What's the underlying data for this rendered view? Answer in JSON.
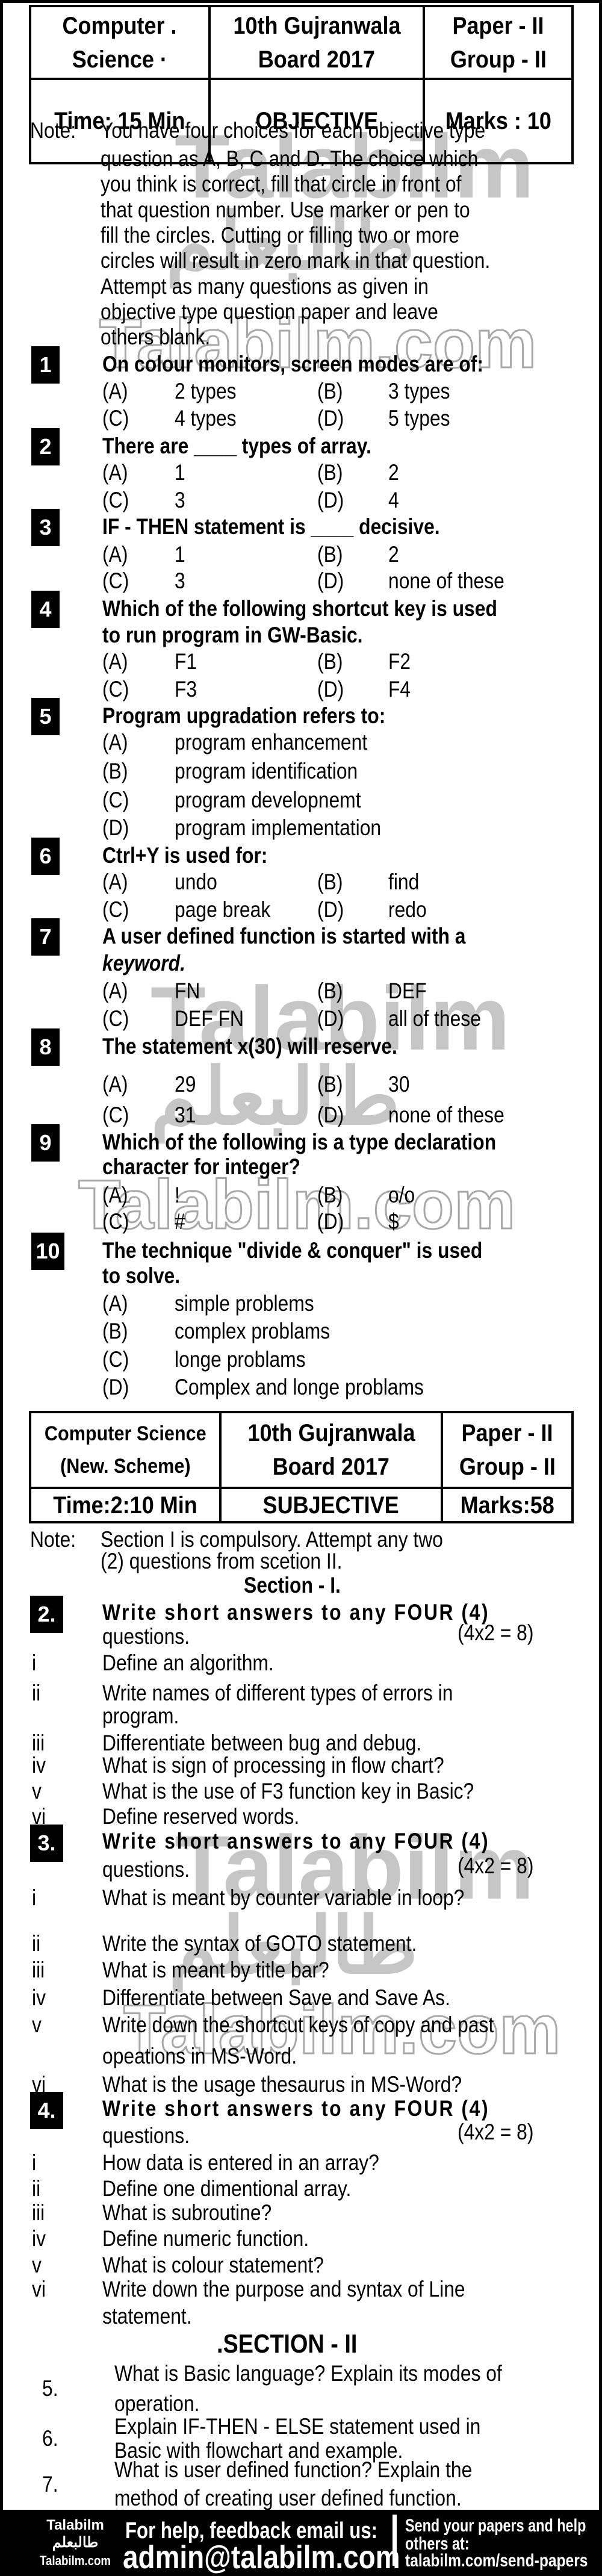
{
  "objective": {
    "header": {
      "subject": [
        "Computer .",
        "Science ·"
      ],
      "board": [
        "10th Gujranwala",
        "Board 2017"
      ],
      "paper": [
        "Paper - II",
        "Group - II"
      ],
      "time": "Time: 15 Min",
      "type": "OBJECTIVE",
      "marks": "Marks : 10"
    },
    "note_label": "Note:",
    "note_lines": [
      "You have four choices for each objective type",
      "question as A, B, C and D. The choice which",
      "you think is correct, fill that circle in front of",
      "that question number. Use marker or pen to",
      "fill the circles. Cutting or filling two or more",
      "circles will result in zero mark in that question.",
      "Attempt as many questions as given in",
      "objective type question paper and leave",
      "others blank."
    ],
    "questions": [
      {
        "num": "1",
        "lines": [
          "On colour monitors, screen modes are of:"
        ],
        "options": [
          [
            "(A)",
            "2 types"
          ],
          [
            "(B)",
            "3 types"
          ],
          [
            "(C)",
            "4 types"
          ],
          [
            "(D)",
            "5 types"
          ]
        ]
      },
      {
        "num": "2",
        "lines": [
          "There are ____ types of array."
        ],
        "options": [
          [
            "(A)",
            "1"
          ],
          [
            "(B)",
            "2"
          ],
          [
            "(C)",
            "3"
          ],
          [
            "(D)",
            "4"
          ]
        ]
      },
      {
        "num": "3",
        "lines": [
          "IF - THEN statement is ____ decisive."
        ],
        "options": [
          [
            "(A)",
            "1"
          ],
          [
            "(B)",
            "2"
          ],
          [
            "(C)",
            "3"
          ],
          [
            "(D)",
            "none of these"
          ]
        ]
      },
      {
        "num": "4",
        "lines": [
          "Which of the following shortcut key is used",
          "to run program in GW-Basic."
        ],
        "options": [
          [
            "(A)",
            "F1"
          ],
          [
            "(B)",
            "F2"
          ],
          [
            "(C)",
            "F3"
          ],
          [
            "(D)",
            "F4"
          ]
        ]
      },
      {
        "num": "5",
        "lines": [
          "Program upgradation refers to:"
        ],
        "options": [
          [
            "(A)",
            "program enhancement"
          ],
          [
            "(B)",
            "program identification"
          ],
          [
            "(C)",
            "program developnemt"
          ],
          [
            "(D)",
            "program implementation"
          ]
        ]
      },
      {
        "num": "6",
        "lines": [
          "Ctrl+Y is used for:"
        ],
        "options": [
          [
            "(A)",
            "undo"
          ],
          [
            "(B)",
            "find"
          ],
          [
            "(C)",
            "page break"
          ],
          [
            "(D)",
            "redo"
          ]
        ]
      },
      {
        "num": "7",
        "lines": [
          "A user defined function is started with a",
          "keyword."
        ],
        "options": [
          [
            "(A)",
            "FN"
          ],
          [
            "(B)",
            "DEF"
          ],
          [
            "(C)",
            "DEF FN"
          ],
          [
            "(D)",
            "all of these"
          ]
        ]
      },
      {
        "num": "8",
        "lines": [
          "The statement x(30) will reserve."
        ],
        "options": [
          [
            "(A)",
            "29"
          ],
          [
            "(B)",
            "30"
          ],
          [
            "(C)",
            "31"
          ],
          [
            "(D)",
            "none of these"
          ]
        ]
      },
      {
        "num": "9",
        "lines": [
          "Which of the following is a type declaration",
          "character for integer?"
        ],
        "options": [
          [
            "(A)",
            "!"
          ],
          [
            "(B)",
            "o/o"
          ],
          [
            "(C)",
            "#"
          ],
          [
            "(D)",
            "$"
          ]
        ]
      },
      {
        "num": "10",
        "lines": [
          "The technique \"divide & conquer\" is used",
          "to solve."
        ],
        "options": [
          [
            "(A)",
            "simple problems"
          ],
          [
            "(B)",
            "complex problams"
          ],
          [
            "(C)",
            "longe problams"
          ],
          [
            "(D)",
            "Complex and longe problams"
          ]
        ]
      }
    ]
  },
  "subjective": {
    "header": {
      "subject": [
        "Computer Science",
        "(New. Scheme)"
      ],
      "board": [
        "10th Gujranwala",
        "Board 2017"
      ],
      "paper": [
        "Paper - II",
        "Group - II"
      ],
      "time": "Time:2:10 Min",
      "type": "SUBJECTIVE",
      "marks": "Marks:58"
    },
    "note_label": "Note:",
    "note_lines": [
      "Section I is compulsory. Attempt any two",
      "(2) questions from scetion II."
    ],
    "section1_title": "Section - I.",
    "short_questions": [
      {
        "num": "2.",
        "heading": [
          "Write short answers to any FOUR (4)",
          "questions."
        ],
        "marks": "(4x2 = 8)",
        "items": [
          {
            "roman": "i",
            "lines": [
              "Define an algorithm."
            ]
          },
          {
            "roman": "ii",
            "lines": [
              "Write names of different types of errors in",
              "program."
            ]
          },
          {
            "roman": "iii",
            "lines": [
              "Differentiate between bug and debug."
            ]
          },
          {
            "roman": "iv",
            "lines": [
              "What is sign of processing in flow chart?"
            ]
          },
          {
            "roman": "v",
            "lines": [
              "What is the use of F3 function key in Basic?"
            ]
          },
          {
            "roman": "vi",
            "lines": [
              "Define reserved words."
            ]
          }
        ]
      },
      {
        "num": "3.",
        "heading": [
          "Write short answers to any FOUR (4)",
          "questions."
        ],
        "marks": "(4x2 = 8)",
        "items": [
          {
            "roman": "i",
            "lines": [
              "What is meant by counter variable in loop?"
            ]
          },
          {
            "roman": "ii",
            "lines": [
              "Write the syntax of GOTO statement."
            ]
          },
          {
            "roman": "iii",
            "lines": [
              "What is meant by title bar?"
            ]
          },
          {
            "roman": "iv",
            "lines": [
              "Differentiate between Save and Save As."
            ]
          },
          {
            "roman": "v",
            "lines": [
              "Write down the shortcut keys of copy and past",
              "opeations in MS-Word."
            ]
          },
          {
            "roman": "vi",
            "lines": [
              "What is the usage thesaurus in MS-Word?"
            ]
          }
        ]
      },
      {
        "num": "4.",
        "heading": [
          "Write short answers to any FOUR (4)",
          "questions."
        ],
        "marks": "(4x2 = 8)",
        "items": [
          {
            "roman": "i",
            "lines": [
              "How data is entered in an array?"
            ]
          },
          {
            "roman": "ii",
            "lines": [
              "Define one dimentional array."
            ]
          },
          {
            "roman": "iii",
            "lines": [
              "What is subroutine?"
            ]
          },
          {
            "roman": "iv",
            "lines": [
              "Define numeric function."
            ]
          },
          {
            "roman": "v",
            "lines": [
              "What is colour statement?"
            ]
          },
          {
            "roman": "vi",
            "lines": [
              "Write down the purpose and syntax of Line",
              "statement."
            ]
          }
        ]
      }
    ],
    "section2_title": ".SECTION - II",
    "long_questions": [
      {
        "num": "5.",
        "lines": [
          "What is Basic language? Explain its modes of",
          "operation."
        ]
      },
      {
        "num": "6.",
        "lines": [
          "Explain IF-THEN - ELSE statement used in",
          "Basic with flowchart and example."
        ]
      },
      {
        "num": "7.",
        "lines": [
          "What is user defined function? Explain the",
          "method of creating user defined function."
        ]
      }
    ]
  },
  "watermarks": {
    "latin": "Talabilm",
    "latin_com": "Talabilm.com",
    "arabic": "طالبعلم"
  },
  "footer": {
    "logo_top": "Talabilm",
    "logo_arabic": "طالبعلم",
    "logo_bottom": "Talabilm.com",
    "help_text": "For help, feedback email us:",
    "email": "admin@talabilm.com",
    "send_text_1": "Send your papers and help",
    "send_text_2": "others at:",
    "send_link": "talabilm.com/send-papers"
  }
}
